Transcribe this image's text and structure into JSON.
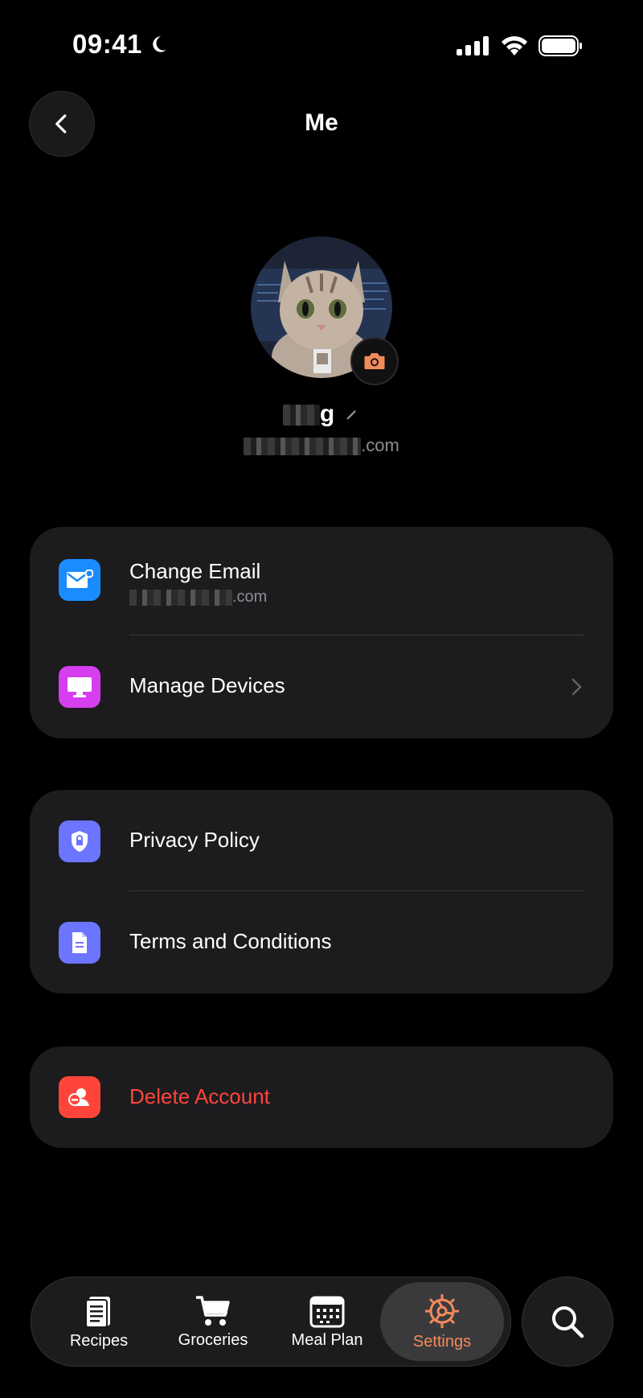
{
  "status": {
    "time": "09:41"
  },
  "header": {
    "title": "Me"
  },
  "profile": {
    "name_visible": "g",
    "email_suffix": ".com"
  },
  "account": {
    "change_email": {
      "label": "Change Email",
      "email_suffix": ".com"
    },
    "manage_devices": {
      "label": "Manage Devices"
    }
  },
  "legal": {
    "privacy": {
      "label": "Privacy Policy"
    },
    "terms": {
      "label": "Terms and Conditions"
    }
  },
  "danger": {
    "delete": {
      "label": "Delete Account"
    }
  },
  "tabs": [
    {
      "label": "Recipes"
    },
    {
      "label": "Groceries"
    },
    {
      "label": "Meal Plan"
    },
    {
      "label": "Settings"
    }
  ],
  "colors": {
    "accent": "#f38a5b",
    "danger": "#ff453a",
    "email_icon": "#1a8cff",
    "devices_icon": "#d63ef0",
    "legal_icon": "#6b75ff"
  }
}
